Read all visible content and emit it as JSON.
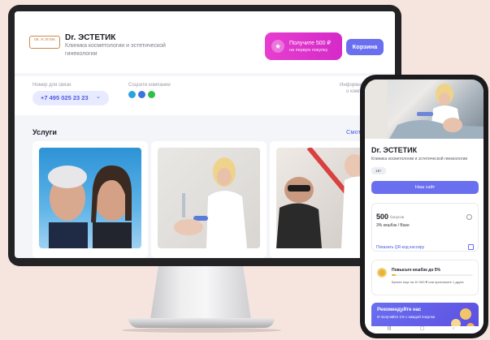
{
  "desktop": {
    "brand": "Dr. ЭСТЕТИК",
    "subtitle": "Клиника косметологии и эстетической гинекологии",
    "logo_text": "DR. ЭСТЕТИК",
    "promo": {
      "title": "Получите 500 ₽",
      "subtitle": "на первую покупку"
    },
    "cart_label": "Корзина",
    "contact_label": "Номер для связи",
    "phone": "+7 495 025 23 23",
    "social_label": "Соцсети компании",
    "info_label": "Информация",
    "info_sub": "о компании",
    "services_title": "Услуги",
    "see_all": "Смотреть"
  },
  "phone": {
    "brand": "Dr. ЭСТЕТИК",
    "subtitle": "Клиника косметологии и эстетической гинекологии",
    "tag": "18+",
    "site_button": "Наш сайт",
    "bonus_amount": "500",
    "bonus_label": "бонусов",
    "cashback": "3% кешбэк / Base",
    "qr_link": "Показать QR-код кассиру",
    "upgrade_title": "Повысьте кешбэк до 5%",
    "upgrade_note": "Купите еще на 10 000 ₽ или пригласите 1 друга",
    "upgrade_progress": 0.05,
    "referral_title": "Рекомендуйте нас",
    "referral_sub": "И получайте 1% с каждой покупки"
  },
  "colors": {
    "accent": "#6a6ff0",
    "promo": "#e63ecf",
    "background": "#f6e4df"
  },
  "icons": {
    "social": [
      "telegram-icon",
      "vk-icon",
      "whatsapp-icon"
    ]
  }
}
